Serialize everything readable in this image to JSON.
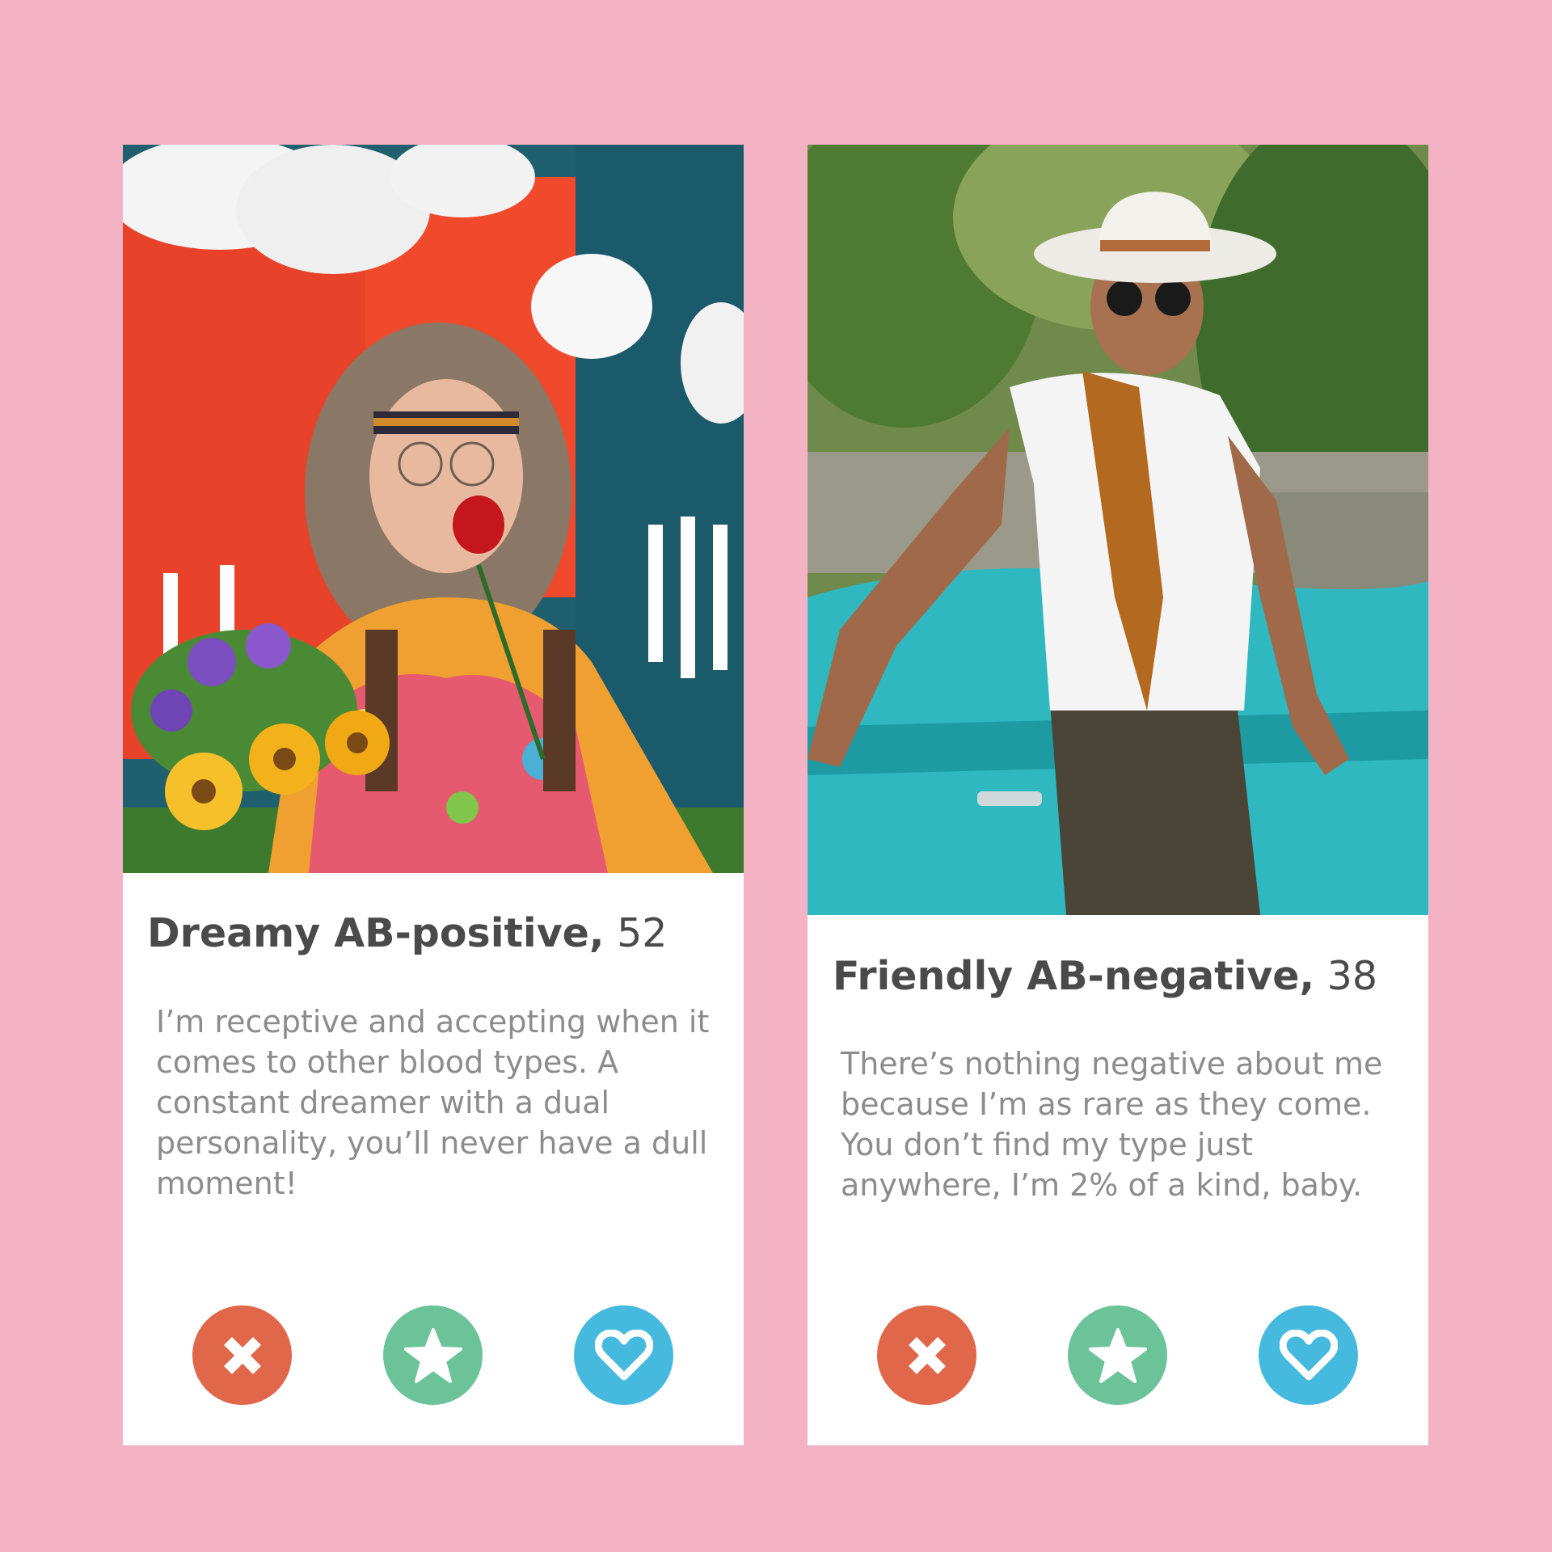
{
  "page": {
    "background_color": "#f3b3c4"
  },
  "colors": {
    "pass": "#e0674a",
    "star": "#6cc39a",
    "like": "#45b9de",
    "name_text": "#4a4a4a",
    "bio_text": "#8c8c8c"
  },
  "profiles": [
    {
      "name": "Dreamy AB-positive,",
      "age": "52",
      "bio": "I’m receptive and accepting when it comes to other blood types. A constant dreamer with a dual personality, you’ll never have a dull moment!",
      "photo": "woman-with-rose-and-flowers-photo",
      "actions": [
        {
          "icon": "close-icon"
        },
        {
          "icon": "star-icon"
        },
        {
          "icon": "heart-icon"
        }
      ]
    },
    {
      "name": "Friendly AB-negative,",
      "age": "38",
      "bio": "There’s nothing negative about me because I’m as rare as they come. You don’t find my type just anywhere, I’m 2% of a kind, baby.",
      "photo": "man-in-hat-by-car-photo",
      "actions": [
        {
          "icon": "close-icon"
        },
        {
          "icon": "star-icon"
        },
        {
          "icon": "heart-icon"
        }
      ]
    }
  ]
}
